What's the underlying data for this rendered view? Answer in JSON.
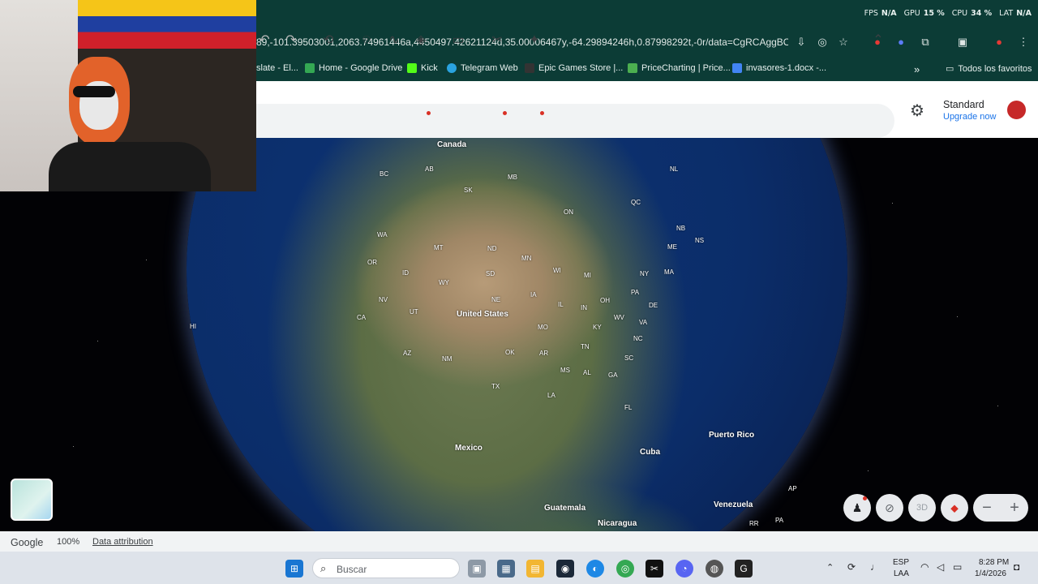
{
  "overlay": {
    "fps_label": "FPS",
    "fps_value": "N/A",
    "gpu_label": "GPU",
    "gpu_value": "15 %",
    "cpu_label": "CPU",
    "cpu_value": "34 %",
    "lat_label": "LAT",
    "lat_value": "N/A"
  },
  "browser": {
    "url": "89,-101.39503001,2063.74961446a,4450497.42621124d,35.00006467y,-64.29894246h,0.87998292t,-0r/data=CgRCAggBOgMK...",
    "bookmarks": [
      {
        "label": "slate - El..."
      },
      {
        "label": "Home - Google Drive"
      },
      {
        "label": "Kick"
      },
      {
        "label": "Telegram Web"
      },
      {
        "label": "Epic Games Store |..."
      },
      {
        "label": "PriceCharting | Price..."
      },
      {
        "label": "invasores-1.docx -..."
      }
    ],
    "more_label": "»",
    "all_bookmarks": "Todos los favoritos"
  },
  "earth": {
    "plan_name": "Standard",
    "upgrade_label": "Upgrade now",
    "status": {
      "brand": "Google",
      "zoom": "100%",
      "attribution": "Data attribution"
    },
    "three_d": "3D"
  },
  "map_labels": {
    "canada": "Canada",
    "bc": "BC",
    "ab": "AB",
    "sk": "SK",
    "mb": "MB",
    "on": "ON",
    "qc": "QC",
    "nl": "NL",
    "nb": "NB",
    "ns": "NS",
    "wa": "WA",
    "or": "OR",
    "mt": "MT",
    "id": "ID",
    "wy": "WY",
    "nd": "ND",
    "sd": "SD",
    "mn": "MN",
    "wi": "WI",
    "mi": "MI",
    "ny": "NY",
    "ma": "MA",
    "me": "ME",
    "ca": "CA",
    "nv": "NV",
    "ut": "UT",
    "ne": "NE",
    "ia": "IA",
    "il": "IL",
    "in": "IN",
    "oh": "OH",
    "pa": "PA",
    "de": "DE",
    "wv": "WV",
    "va": "VA",
    "mo": "MO",
    "ky": "KY",
    "nc": "NC",
    "az": "AZ",
    "nm": "NM",
    "ok": "OK",
    "ar": "AR",
    "tn": "TN",
    "sc": "SC",
    "ms": "MS",
    "al": "AL",
    "ga": "GA",
    "tx": "TX",
    "la": "LA",
    "fl": "FL",
    "hi": "HI",
    "united_states": "United States",
    "mexico": "Mexico",
    "cuba": "Cuba",
    "puerto_rico": "Puerto Rico",
    "guatemala": "Guatemala",
    "nicaragua": "Nicaragua",
    "venezuela": "Venezuela",
    "ap": "AP",
    "rr": "RR",
    "pa2": "PA"
  },
  "taskbar": {
    "search_placeholder": "Buscar",
    "lang": "ESP",
    "layout": "LAA",
    "time": "8:28 PM",
    "date": "1/4/2026"
  }
}
